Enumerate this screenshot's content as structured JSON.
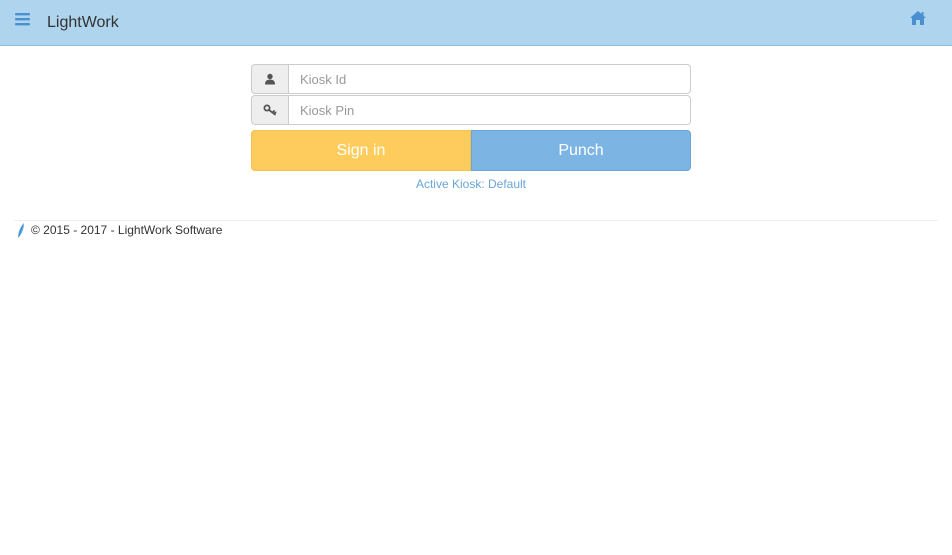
{
  "navbar": {
    "brand": "LightWork",
    "menu_icon": "hamburger-menu-icon",
    "home_icon": "home-icon",
    "background_color": "#aed4ee",
    "icon_color": "#4a8fd0"
  },
  "login_form": {
    "kiosk_id": {
      "icon": "user-icon",
      "placeholder": "Kiosk Id",
      "value": ""
    },
    "kiosk_pin": {
      "icon": "key-icon",
      "placeholder": "Kiosk Pin",
      "value": ""
    },
    "sign_in_label": "Sign in",
    "punch_label": "Punch",
    "sign_in_color": "#fecc5d",
    "punch_color": "#7cb4e4",
    "active_kiosk": "Active Kiosk: Default"
  },
  "footer": {
    "icon": "leaf-logo-icon",
    "copyright": "© 2015 - 2017 - LightWork Software"
  }
}
